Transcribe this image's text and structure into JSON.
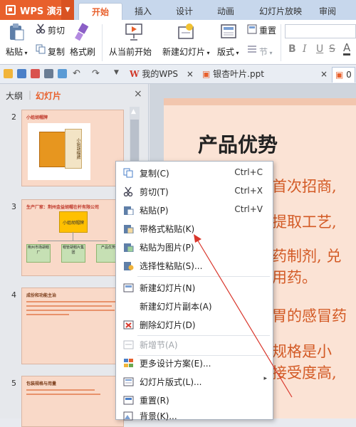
{
  "app": {
    "name": "WPS 演示"
  },
  "tabs": [
    {
      "label": "开始",
      "active": true
    },
    {
      "label": "插入"
    },
    {
      "label": "设计"
    },
    {
      "label": "动画"
    },
    {
      "label": "幻灯片放映"
    },
    {
      "label": "审阅"
    }
  ],
  "ribbon": {
    "paste": "粘贴",
    "cut": "剪切",
    "copy": "复制",
    "format_brush": "格式刷",
    "from_current": "从当前开始",
    "new_slide": "新建幻灯片",
    "layout": "版式",
    "reset": "重置",
    "section": "节",
    "bold": "B",
    "italic": "I",
    "underline": "U",
    "strike": "S",
    "font_color": "A"
  },
  "doc_tabs": [
    {
      "label": "我的WPS"
    },
    {
      "label": "银杏叶片.ppt"
    },
    {
      "label": "0"
    }
  ],
  "left_pane": {
    "outline_tab": "大纲",
    "slides_tab": "幻灯片",
    "close": "×",
    "slides": [
      {
        "num": "2",
        "title": "小姐胡帽牌",
        "box_text": "小姐胡帽牌"
      },
      {
        "num": "3",
        "title": "生产厂家：荆州金益胡帽在杆有限公司",
        "top_node": "小姐胡帽牌",
        "nodes": [
          "荆州市场胡帽厂",
          "帽管胡帽片集团",
          "产品优势"
        ]
      },
      {
        "num": "4",
        "title": "成份和功能主治"
      },
      {
        "num": "5",
        "title": "包装规格与用量"
      }
    ]
  },
  "slide": {
    "title": "产品优势",
    "lines": [
      "首次招商,",
      "提取工艺,",
      "药制剂, 兑",
      "用药。",
      "胃的感冒药",
      "规格是小",
      "接受度高,"
    ]
  },
  "context_menu": {
    "items": [
      {
        "label": "复制(C)",
        "shortcut": "Ctrl+C",
        "icon": "copy-icon"
      },
      {
        "label": "剪切(T)",
        "shortcut": "Ctrl+X",
        "icon": "scissors-icon"
      },
      {
        "label": "粘贴(P)",
        "shortcut": "Ctrl+V",
        "icon": "paste-icon"
      },
      {
        "label": "带格式粘贴(K)",
        "icon": "paste-format-icon"
      },
      {
        "label": "粘贴为图片(P)",
        "icon": "paste-image-icon"
      },
      {
        "label": "选择性粘贴(S)...",
        "icon": "paste-special-icon"
      },
      {
        "label": "新建幻灯片(N)",
        "icon": "new-slide-icon"
      },
      {
        "label": "新建幻灯片副本(A)"
      },
      {
        "label": "删除幻灯片(D)",
        "icon": "delete-slide-icon"
      },
      {
        "label": "新增节(A)",
        "icon": "section-icon",
        "disabled": true
      },
      {
        "label": "更多设计方案(E)...",
        "icon": "design-icon"
      },
      {
        "label": "幻灯片版式(L)...",
        "icon": "layout-icon",
        "submenu": "▸"
      },
      {
        "label": "重置(R)",
        "icon": "reset-icon"
      },
      {
        "label": "背景(K)...",
        "icon": "background-icon"
      }
    ]
  },
  "colors": {
    "wps_orange": "#e8602c",
    "slide_bg": "#fbe3d5",
    "slide_text": "#d35a25",
    "pointer_line": "#d9362b"
  }
}
